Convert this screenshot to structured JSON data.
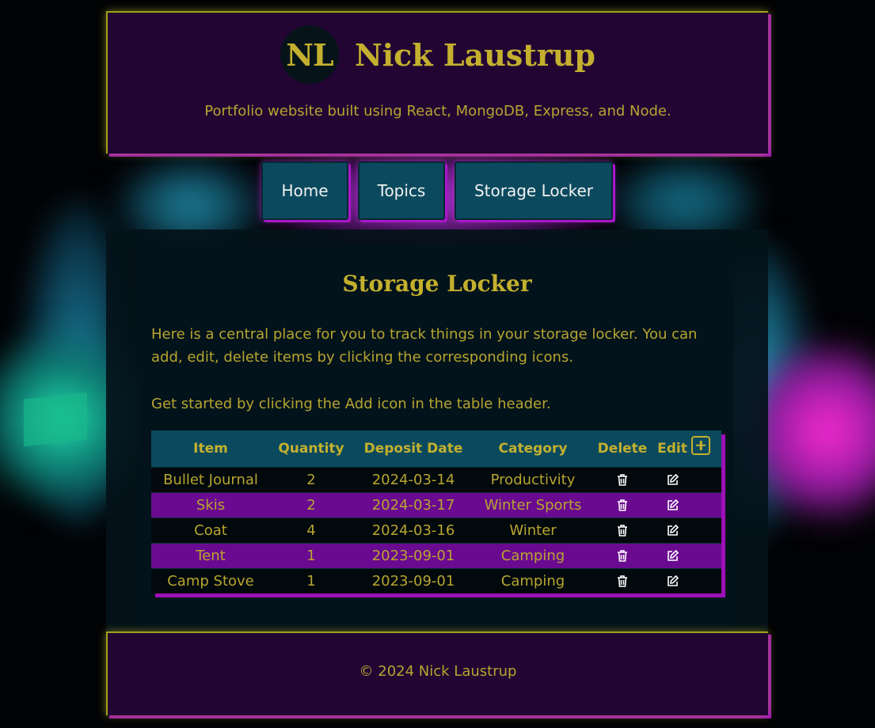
{
  "header": {
    "logo_initials": "NL",
    "title": "Nick Laustrup",
    "tagline": "Portfolio website built using React, MongoDB, Express, and Node."
  },
  "nav": {
    "items": [
      {
        "label": "Home"
      },
      {
        "label": "Topics"
      },
      {
        "label": "Storage Locker"
      }
    ]
  },
  "main": {
    "title": "Storage Locker",
    "intro": "Here is a central place for you to track things in your storage locker. You can add, edit, delete items by clicking the corresponding icons.",
    "get_started": "Get started by clicking the Add icon in the table header.",
    "table": {
      "headers": {
        "item": "Item",
        "quantity": "Quantity",
        "deposit_date": "Deposit Date",
        "category": "Category",
        "delete": "Delete",
        "edit": "Edit"
      },
      "rows": [
        {
          "item": "Bullet Journal",
          "quantity": "2",
          "deposit_date": "2024-03-14",
          "category": "Productivity"
        },
        {
          "item": "Skis",
          "quantity": "2",
          "deposit_date": "2024-03-17",
          "category": "Winter Sports"
        },
        {
          "item": "Coat",
          "quantity": "4",
          "deposit_date": "2024-03-16",
          "category": "Winter"
        },
        {
          "item": "Tent",
          "quantity": "1",
          "deposit_date": "2023-09-01",
          "category": "Camping"
        },
        {
          "item": "Camp Stove",
          "quantity": "1",
          "deposit_date": "2023-09-01",
          "category": "Camping"
        }
      ]
    }
  },
  "icons": {
    "add": "plus-square-icon",
    "delete": "trash-icon",
    "edit": "edit-icon"
  },
  "colors": {
    "accent_gold": "#c4b02e",
    "header_purple": "#220533",
    "nav_teal": "#0b4a5e",
    "row_purple": "#6a0a90",
    "glow_magenta": "#9c10b8"
  },
  "footer": {
    "copyright": "© 2024 Nick Laustrup"
  }
}
